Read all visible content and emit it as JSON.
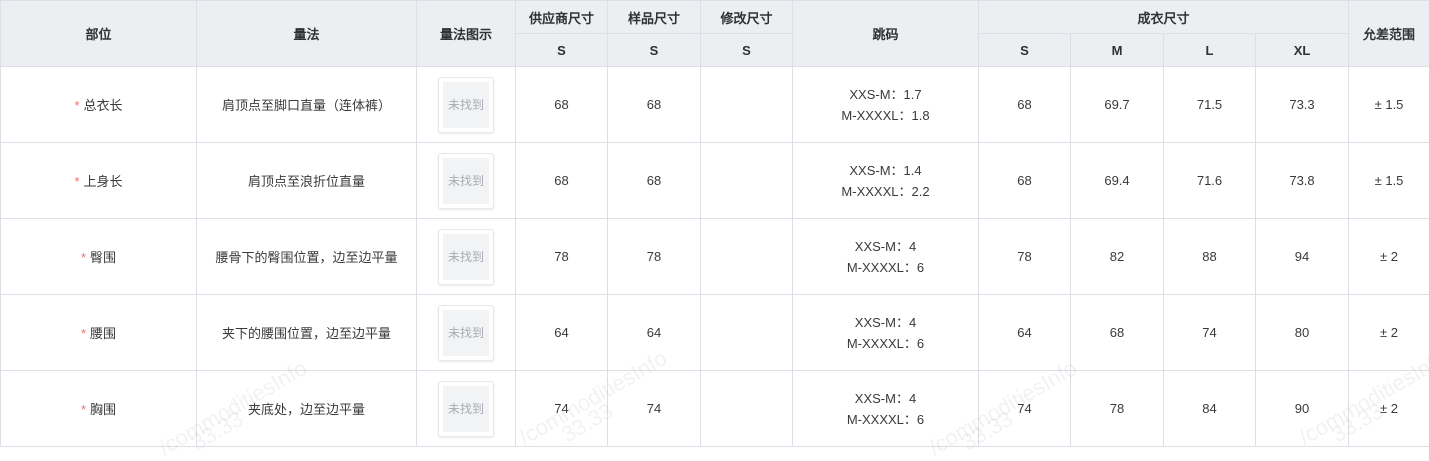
{
  "headers": {
    "part": "部位",
    "method": "量法",
    "diagram": "量法图示",
    "supplier": "供应商尺寸",
    "sample": "样品尺寸",
    "modified": "修改尺寸",
    "jump": "跳码",
    "finished": "成衣尺寸",
    "tolerance": "允差范围",
    "supplier_size": "S",
    "sample_size": "S",
    "modified_size": "S",
    "sizes": [
      "S",
      "M",
      "L",
      "XL"
    ]
  },
  "required_mark": "*",
  "rows": [
    {
      "part": "总衣长",
      "method": "肩顶点至脚口直量（连体裤）",
      "image_text": "未找到",
      "supplier": "68",
      "sample": "68",
      "modified": "",
      "jump1": "XXS-M：1.7",
      "jump2": "M-XXXXL：1.8",
      "s": "68",
      "m": "69.7",
      "l": "71.5",
      "xl": "73.3",
      "tol": "± 1.5"
    },
    {
      "part": "上身长",
      "method": "肩顶点至浪折位直量",
      "image_text": "未找到",
      "supplier": "68",
      "sample": "68",
      "modified": "",
      "jump1": "XXS-M：1.4",
      "jump2": "M-XXXXL：2.2",
      "s": "68",
      "m": "69.4",
      "l": "71.6",
      "xl": "73.8",
      "tol": "± 1.5"
    },
    {
      "part": "臀围",
      "method": "腰骨下的臀围位置，边至边平量",
      "image_text": "未找到",
      "supplier": "78",
      "sample": "78",
      "modified": "",
      "jump1": "XXS-M：4",
      "jump2": "M-XXXXL：6",
      "s": "78",
      "m": "82",
      "l": "88",
      "xl": "94",
      "tol": "± 2"
    },
    {
      "part": "腰围",
      "method": "夹下的腰围位置，边至边平量",
      "image_text": "未找到",
      "supplier": "64",
      "sample": "64",
      "modified": "",
      "jump1": "XXS-M：4",
      "jump2": "M-XXXXL：6",
      "s": "64",
      "m": "68",
      "l": "74",
      "xl": "80",
      "tol": "± 2"
    },
    {
      "part": "胸围",
      "method": "夹底处，边至边平量",
      "image_text": "未找到",
      "supplier": "74",
      "sample": "74",
      "modified": "",
      "jump1": "XXS-M：4",
      "jump2": "M-XXXXL：6",
      "s": "74",
      "m": "78",
      "l": "84",
      "xl": "90",
      "tol": "± 2"
    }
  ],
  "watermarks": [
    "/commoditiesInfo",
    "33.33"
  ]
}
